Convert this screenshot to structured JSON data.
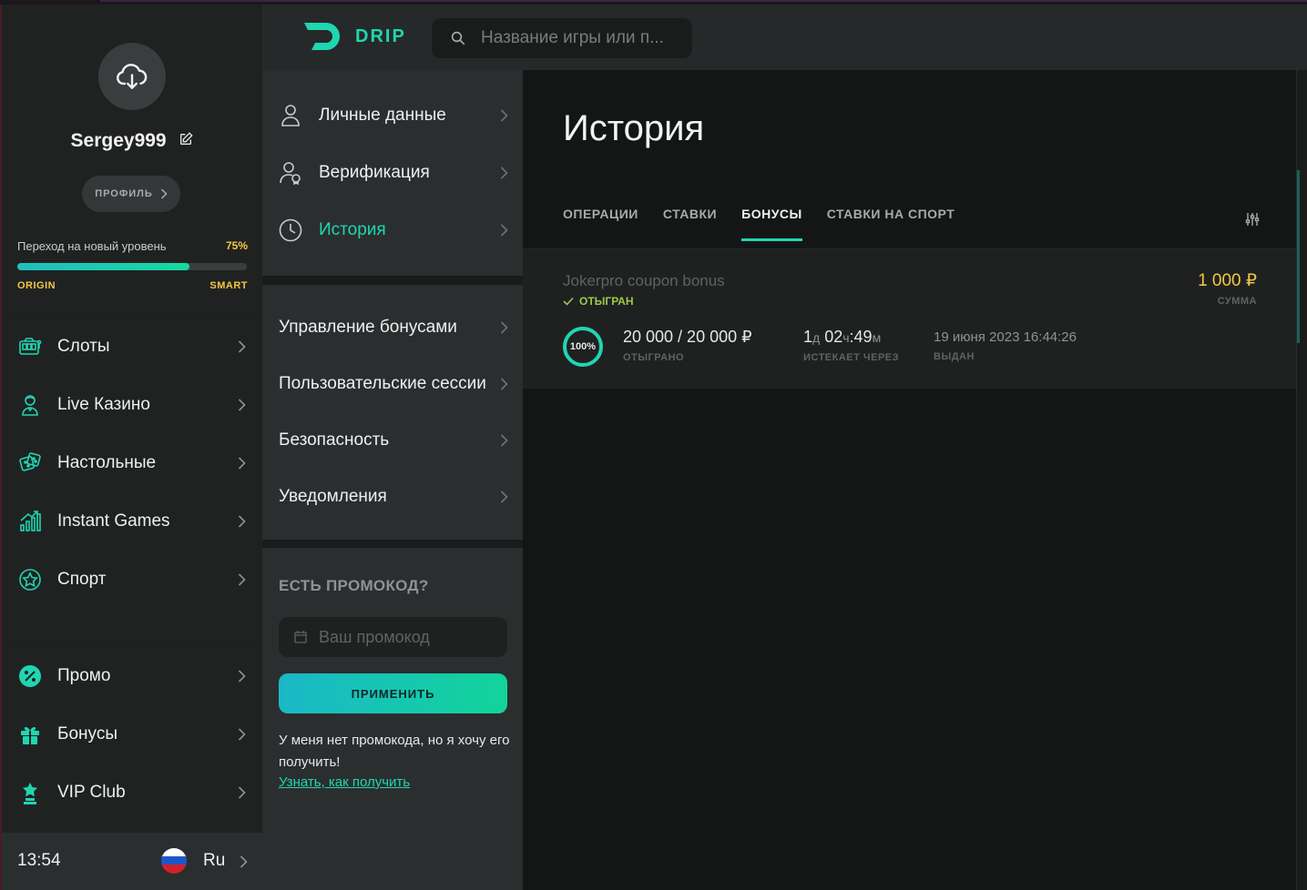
{
  "user": {
    "username": "Sergey999",
    "profile_button": "ПРОФИЛЬ",
    "level_label": "Переход на новый уровень",
    "level_progress_pct": "75%",
    "level_progress": 0.75,
    "level_from": "ORIGIN",
    "level_to": "SMART"
  },
  "sidebar": {
    "games": [
      {
        "label": "Слоты",
        "icon": "slot-machine-icon"
      },
      {
        "label": "Live Казино",
        "icon": "dealer-icon"
      },
      {
        "label": "Настольные",
        "icon": "dice-icon"
      },
      {
        "label": "Instant Games",
        "icon": "chart-bars-icon"
      },
      {
        "label": "Спорт",
        "icon": "star-badge-icon"
      }
    ],
    "extras": [
      {
        "label": "Промо",
        "icon": "percent-icon"
      },
      {
        "label": "Бонусы",
        "icon": "gift-icon"
      },
      {
        "label": "VIP Club",
        "icon": "trophy-icon"
      }
    ],
    "footer": {
      "time": "13:54",
      "language": "Ru",
      "flag": "russia-flag-icon"
    }
  },
  "header": {
    "logo_text": "DRIP",
    "search_placeholder": "Название игры или п..."
  },
  "account_menu": {
    "primary": [
      {
        "label": "Личные данные",
        "icon": "user-icon",
        "active": false
      },
      {
        "label": "Верификация",
        "icon": "verified-user-icon",
        "active": false
      },
      {
        "label": "История",
        "icon": "clock-icon",
        "active": true
      }
    ],
    "secondary": [
      {
        "label": "Управление бонусами"
      },
      {
        "label": "Пользовательские сессии"
      },
      {
        "label": "Безопасность"
      },
      {
        "label": "Уведомления"
      }
    ]
  },
  "promo": {
    "title": "ЕСТЬ ПРОМОКОД?",
    "input_placeholder": "Ваш промокод",
    "apply_button": "ПРИМЕНИТЬ",
    "note": "У меня нет промокода, но я хочу его получить!",
    "link": "Узнать, как получить"
  },
  "history": {
    "title": "История",
    "tabs": [
      "ОПЕРАЦИИ",
      "СТАВКИ",
      "БОНУСЫ",
      "СТАВКИ НА СПОРТ"
    ],
    "active_tab": "БОНУСЫ",
    "bonus": {
      "name": "Jokerpro coupon bonus",
      "status": "ОТЫГРАН",
      "amount": "1 000 ₽",
      "amount_label": "СУММА",
      "progress_label": "100%",
      "wagered": "20 000 / 20 000 ₽",
      "wagered_label": "ОТЫГРАНО",
      "expires_days": "1",
      "expires_days_unit": "д",
      "expires_hours": "02",
      "expires_hours_unit": "ч",
      "expires_minutes": "49",
      "expires_minutes_unit": "м",
      "expires_label": "ИСТЕКАЕТ ЧЕРЕЗ",
      "issued": "19 июня 2023 16:44:26",
      "issued_label": "ВЫДАН"
    }
  },
  "colors": {
    "accent": "#1fd6b1",
    "gold": "#f3c842",
    "status_green": "#9ec84a"
  }
}
